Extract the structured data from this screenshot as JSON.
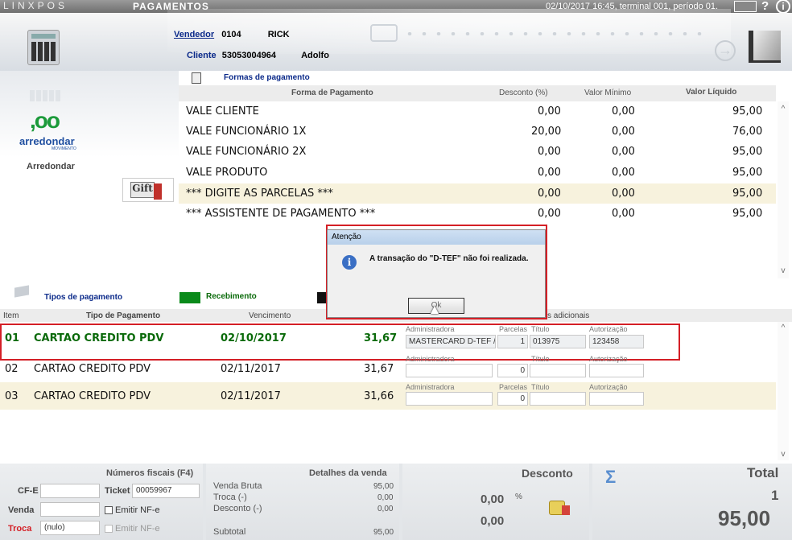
{
  "topbar": {
    "logo": "LINXPOS",
    "title": "PAGAMENTOS",
    "datetime": "02/10/2017 16:45, terminal 001, período 01.",
    "help": "?",
    "info": "i"
  },
  "header": {
    "vendedor_label": "Vendedor",
    "vendedor_code": "0104",
    "vendedor_name": "RICK",
    "cliente_label": "Cliente",
    "cliente_code": "53053004964",
    "cliente_name": "Adolfo",
    "arrow": "→"
  },
  "left": {
    "arredondar_logo": ",oo",
    "arredondar_brand": "arredondar",
    "arredondar_sub": "MOVIMENTO",
    "arredondar_label": "Arredondar",
    "gift_label": "Gift"
  },
  "formas": {
    "tab_label": "Formas de pagamento",
    "columns": [
      "Forma de Pagamento",
      "Desconto (%)",
      "Valor Mínimo",
      "Valor Líquido"
    ],
    "rows": [
      {
        "name": "VALE CLIENTE",
        "desconto": "0,00",
        "minimo": "0,00",
        "liquido": "95,00"
      },
      {
        "name": "VALE FUNCIONÁRIO 1X",
        "desconto": "20,00",
        "minimo": "0,00",
        "liquido": "76,00"
      },
      {
        "name": "VALE FUNCIONÁRIO 2X",
        "desconto": "0,00",
        "minimo": "0,00",
        "liquido": "95,00"
      },
      {
        "name": "VALE PRODUTO",
        "desconto": "0,00",
        "minimo": "0,00",
        "liquido": "95,00"
      },
      {
        "name": "*** DIGITE AS PARCELAS ***",
        "desconto": "0,00",
        "minimo": "0,00",
        "liquido": "95,00"
      },
      {
        "name": "*** ASSISTENTE DE PAGAMENTO ***",
        "desconto": "0,00",
        "minimo": "0,00",
        "liquido": "95,00"
      }
    ],
    "scroll_up": "^",
    "scroll_down": "v"
  },
  "tipos": {
    "tab_label": "Tipos de pagamento",
    "receb_label": "Recebimento",
    "columns": {
      "item": "Item",
      "tipo": "Tipo de Pagamento",
      "venc": "Vencimento",
      "info": "Informações adicionais"
    },
    "rows": [
      {
        "item": "01",
        "tipo": "CARTAO CREDITO PDV",
        "venc": "02/10/2017",
        "valor": "31,67",
        "admin": "MASTERCARD D-TEF /",
        "parcelas": "1",
        "titulo": "013975",
        "autorizacao": "123458"
      },
      {
        "item": "02",
        "tipo": "CARTAO CREDITO PDV",
        "venc": "02/11/2017",
        "valor": "31,67",
        "admin": "",
        "parcelas": "0",
        "titulo": "",
        "autorizacao": ""
      },
      {
        "item": "03",
        "tipo": "CARTAO CREDITO PDV",
        "venc": "02/11/2017",
        "valor": "31,66",
        "admin": "",
        "parcelas": "0",
        "titulo": "",
        "autorizacao": ""
      }
    ],
    "labels": {
      "admin": "Administradora",
      "parcelas": "Parcelas",
      "titulo": "Título",
      "autorizacao": "Autorização"
    },
    "scroll_up": "^",
    "scroll_down": "v"
  },
  "dialog": {
    "title": "Atenção",
    "message": "A transação do \"D-TEF\" não foi realizada.",
    "ok": "Ok"
  },
  "footer": {
    "fiscais_title": "Números fiscais (F4)",
    "cfe_label": "CF-E",
    "ticket_label": "Ticket",
    "ticket_value": "00059967",
    "venda_label": "Venda",
    "emitir1": "Emitir NF-e",
    "troca_label": "Troca",
    "troca_value": "(nulo)",
    "emitir2": "Emitir NF-e",
    "detalhes_title": "Detalhes da venda",
    "venda_bruta_label": "Venda Bruta",
    "venda_bruta_value": "95,00",
    "troca_det_label": "Troca (-)",
    "troca_det_value": "0,00",
    "desconto_det_label": "Desconto (-)",
    "desconto_det_value": "0,00",
    "subtotal_label": "Subtotal",
    "subtotal_value": "95,00",
    "desconto_title": "Desconto",
    "desconto_pct": "0,00",
    "pct_symbol": "%",
    "desconto_val": "0,00",
    "total_title": "Total",
    "sigma": "Σ",
    "total_qty": "1",
    "total_value": "95,00"
  }
}
